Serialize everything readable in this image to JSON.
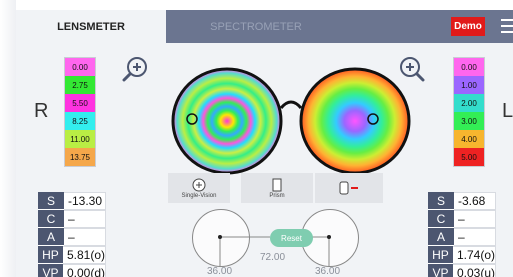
{
  "tabs": {
    "lensmeter": "LENSMETER",
    "spectrometer": "SPECTROMETER"
  },
  "demo_label": "Demo",
  "left_letter": "R",
  "right_letter": "L",
  "left_scale": [
    {
      "label": "0.00",
      "color": "#ff66ee"
    },
    {
      "label": "2.75",
      "color": "#33e833"
    },
    {
      "label": "5.50",
      "color": "#ff33e0"
    },
    {
      "label": "8.25",
      "color": "#33eeee"
    },
    {
      "label": "11.00",
      "color": "#b9ee44"
    },
    {
      "label": "13.75",
      "color": "#f5a74a"
    }
  ],
  "right_scale": [
    {
      "label": "0.00",
      "color": "#ff66ee"
    },
    {
      "label": "1.00",
      "color": "#9b66ff"
    },
    {
      "label": "2.00",
      "color": "#33ddcc"
    },
    {
      "label": "3.00",
      "color": "#33ee55"
    },
    {
      "label": "4.00",
      "color": "#f7b52e"
    },
    {
      "label": "5.00",
      "color": "#ee2222"
    }
  ],
  "tools": {
    "single_vision": "Single-Vision",
    "prism": "Prism"
  },
  "left_rx": [
    {
      "k": "S",
      "v": "-13.30"
    },
    {
      "k": "C",
      "v": "–"
    },
    {
      "k": "A",
      "v": "–"
    },
    {
      "k": "HP",
      "v": "5.81(o)"
    },
    {
      "k": "VP",
      "v": "0.00(d)"
    }
  ],
  "right_rx": [
    {
      "k": "S",
      "v": "-3.68"
    },
    {
      "k": "C",
      "v": "–"
    },
    {
      "k": "A",
      "v": "–"
    },
    {
      "k": "HP",
      "v": "1.74(o)"
    },
    {
      "k": "VP",
      "v": "0.03(u)"
    }
  ],
  "reset_label": "Reset",
  "dial_left_value": "36.00",
  "dial_center_value": "72.00",
  "dial_right_value": "36.00"
}
